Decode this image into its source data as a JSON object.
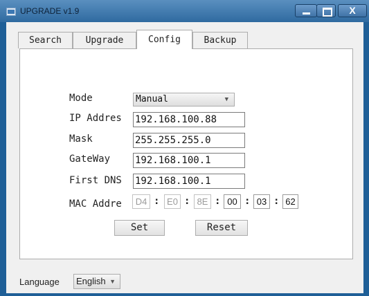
{
  "window": {
    "title": "UPGRADE v1.9",
    "controls": {
      "close": "X"
    }
  },
  "tabs": [
    {
      "label": "Search",
      "active": false
    },
    {
      "label": "Upgrade",
      "active": false
    },
    {
      "label": "Config",
      "active": true
    },
    {
      "label": "Backup",
      "active": false
    }
  ],
  "config": {
    "mode_label": "Mode",
    "mode_value": "Manual",
    "ip_label": "IP Addres",
    "ip_value": "192.168.100.88",
    "mask_label": "Mask",
    "mask_value": "255.255.255.0",
    "gateway_label": "GateWay",
    "gateway_value": "192.168.100.1",
    "dns_label": "First DNS",
    "dns_value": "192.168.100.1",
    "mac_label": "MAC Addre",
    "mac_separator": ":",
    "mac_octets": [
      "D4",
      "E0",
      "8E",
      "00",
      "03",
      "62"
    ],
    "set_label": "Set",
    "reset_label": "Reset"
  },
  "footer": {
    "language_label": "Language",
    "language_value": "English"
  },
  "colors": {
    "titlebar": "#2f6aa0",
    "panel": "#ffffff",
    "client": "#f0f0f0",
    "disabled_text": "#9a9a9a"
  }
}
